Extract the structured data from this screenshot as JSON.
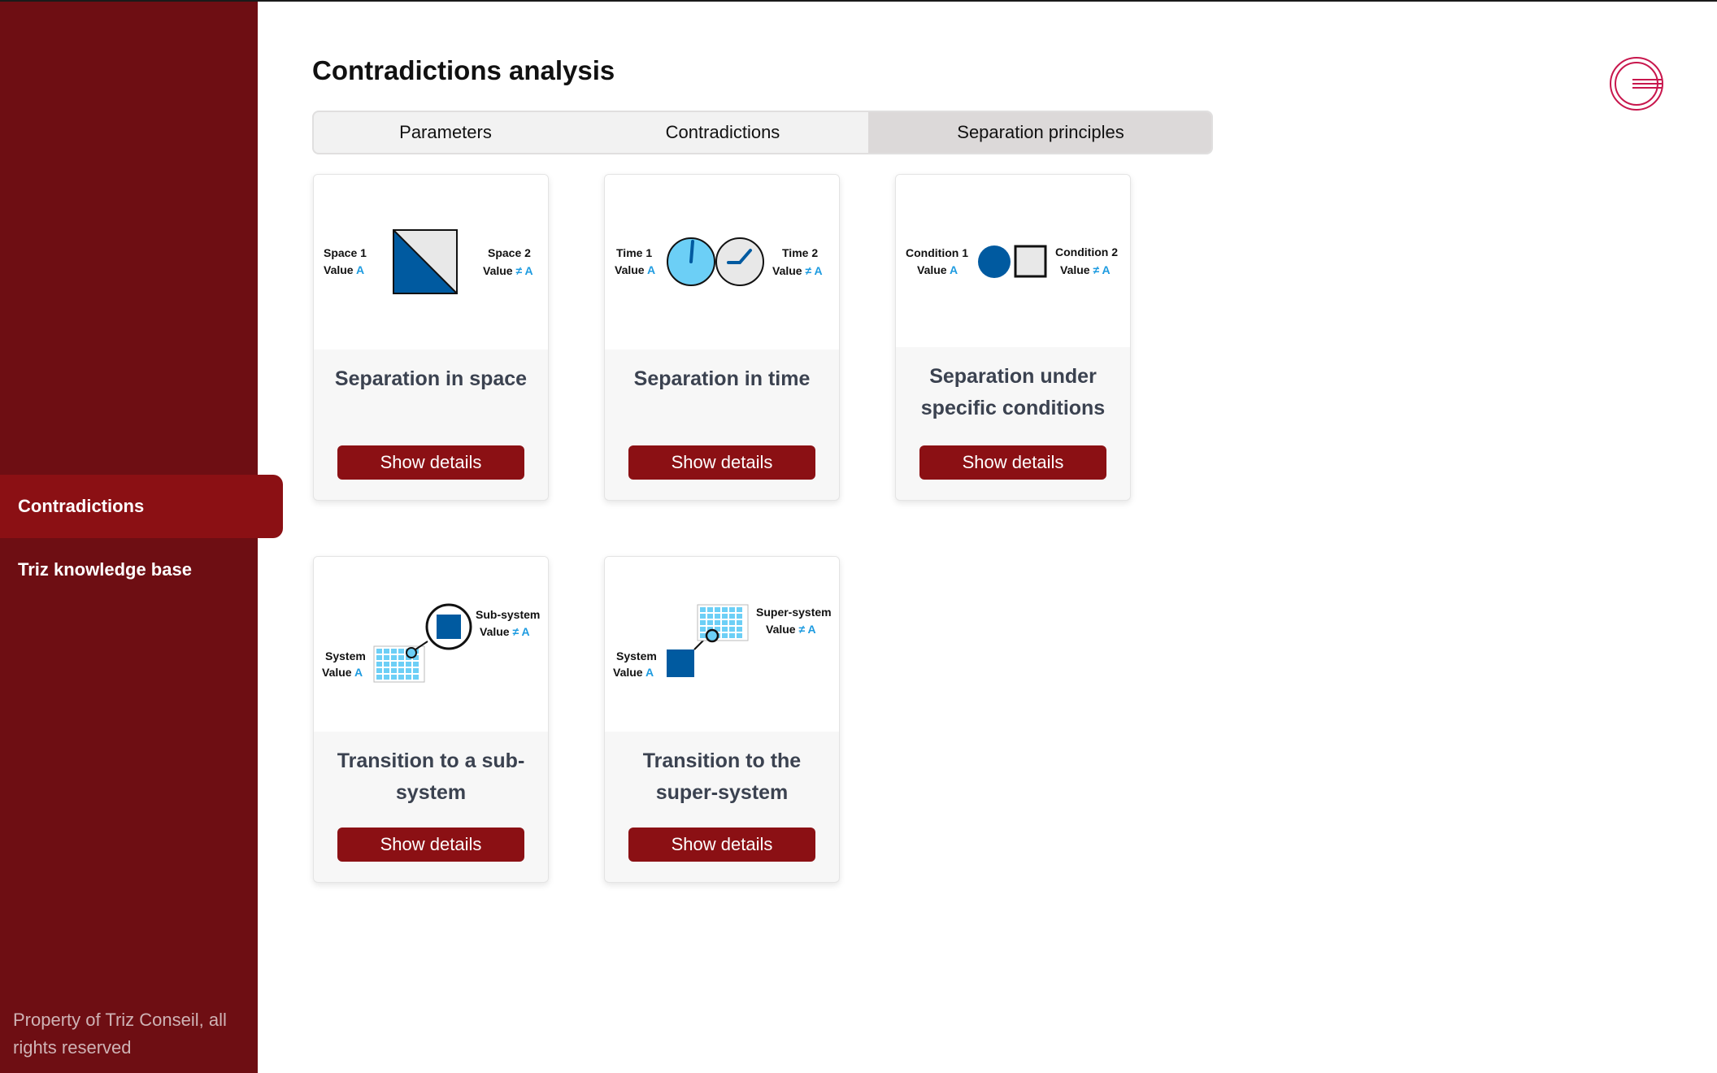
{
  "sidebar": {
    "items": [
      {
        "label": "Contradictions",
        "active": true
      },
      {
        "label": "Triz knowledge base",
        "active": false
      }
    ],
    "footer": "Property of Triz Conseil, all rights reserved"
  },
  "header": {
    "title": "Contradictions analysis",
    "logo_icon": "triz-logo-icon"
  },
  "tabs": [
    {
      "label": "Parameters",
      "active": false
    },
    {
      "label": "Contradictions",
      "active": false
    },
    {
      "label": "Separation principles",
      "active": true
    }
  ],
  "cards": [
    {
      "title": "Separation in space",
      "button": "Show details",
      "diagram": {
        "left_label": "Space 1",
        "left_value": "Value",
        "left_symbol": "A",
        "right_label": "Space 2",
        "right_value": "Value",
        "right_symbol": "≠ A"
      }
    },
    {
      "title": "Separation in time",
      "button": "Show details",
      "diagram": {
        "left_label": "Time 1",
        "left_value": "Value",
        "left_symbol": "A",
        "right_label": "Time 2",
        "right_value": "Value",
        "right_symbol": "≠ A"
      }
    },
    {
      "title": "Separation under specific conditions",
      "button": "Show details",
      "diagram": {
        "left_label": "Condition 1",
        "left_value": "Value",
        "left_symbol": "A",
        "right_label": "Condition 2",
        "right_value": "Value",
        "right_symbol": "≠ A"
      }
    },
    {
      "title": "Transition to a sub-system",
      "button": "Show details",
      "diagram": {
        "left_label": "System",
        "left_value": "Value",
        "left_symbol": "A",
        "right_label": "Sub-system",
        "right_value": "Value",
        "right_symbol": "≠ A"
      }
    },
    {
      "title": "Transition to the super-system",
      "button": "Show details",
      "diagram": {
        "left_label": "System",
        "left_value": "Value",
        "left_symbol": "A",
        "right_label": "Super-system",
        "right_value": "Value",
        "right_symbol": "≠ A"
      }
    }
  ],
  "colors": {
    "sidebar_bg": "#6e0e13",
    "accent": "#8b1014",
    "diagram_blue": "#005aa0",
    "diagram_light_blue": "#6ccff6",
    "value_blue": "#1e9be0"
  }
}
